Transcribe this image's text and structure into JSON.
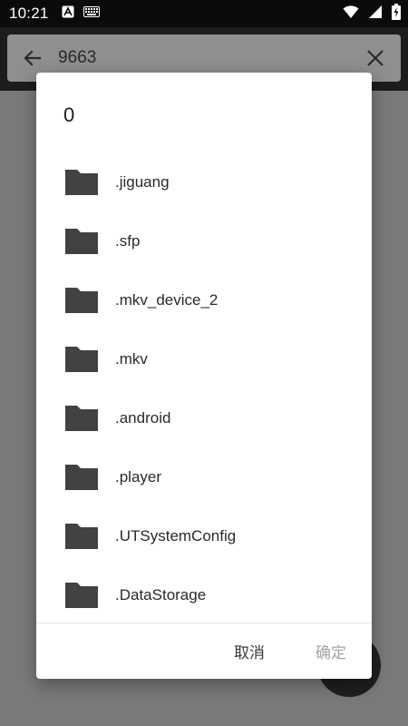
{
  "status_bar": {
    "time": "10:21",
    "left_icons": [
      "app-notification-icon",
      "keyboard-icon"
    ],
    "right_icons": [
      "wifi-icon",
      "cellular-signal-icon",
      "battery-charging-icon"
    ]
  },
  "search": {
    "query": "9663",
    "back_icon": "arrow-left-icon",
    "clear_icon": "close-icon"
  },
  "dialog": {
    "title": "0",
    "items": [
      {
        "label": ".jiguang",
        "icon": "folder-icon"
      },
      {
        "label": ".sfp",
        "icon": "folder-icon"
      },
      {
        "label": ".mkv_device_2",
        "icon": "folder-icon"
      },
      {
        "label": ".mkv",
        "icon": "folder-icon"
      },
      {
        "label": ".android",
        "icon": "folder-icon"
      },
      {
        "label": ".player",
        "icon": "folder-icon"
      },
      {
        "label": ".UTSystemConfig",
        "icon": "folder-icon"
      },
      {
        "label": ".DataStorage",
        "icon": "folder-icon"
      }
    ],
    "cancel_label": "取消",
    "confirm_label": "确定"
  },
  "colors": {
    "scrim": "#7a7a7a",
    "dialog_bg": "#ffffff",
    "folder_icon": "#424242",
    "disabled_text": "#a5a5a5"
  }
}
